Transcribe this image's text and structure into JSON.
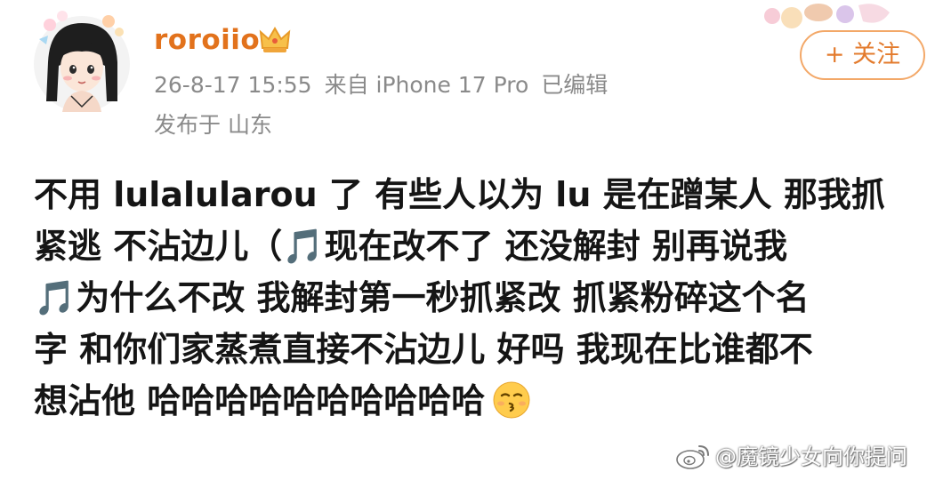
{
  "post": {
    "username": "roroiio",
    "timestamp": "26-8-17 15:55",
    "source": "来自 iPhone 17 Pro",
    "edited": "已编辑",
    "location": "发布于 山东",
    "follow_label": "+ 关注",
    "lines": [
      "不用 lulalularou 了 有些人以为 lu 是在蹭某人 那我抓",
      "紧逃 不沾边儿（🎵现在改不了 还没解封 别再说我",
      "🎵为什么不改 我解封第一秒抓紧改 抓紧粉碎这个名",
      "字 和你们家蒸煮直接不沾边儿 好吗 我现在比谁都不",
      "想沾他 哈哈哈哈哈哈哈哈哈哈"
    ]
  },
  "watermark": {
    "text": "@魔镜少女向你提问"
  },
  "colors": {
    "username": "#e2721c",
    "meta": "#8a8a8a",
    "follow_border": "#f3a868",
    "follow_text": "#e37b2d",
    "body_text": "#151515"
  },
  "icons": {
    "avatar": "avatar-girl",
    "badge": "crown-icon",
    "emoji": "kissing-face-emoji",
    "watermark_logo": "weibo-logo-icon"
  }
}
